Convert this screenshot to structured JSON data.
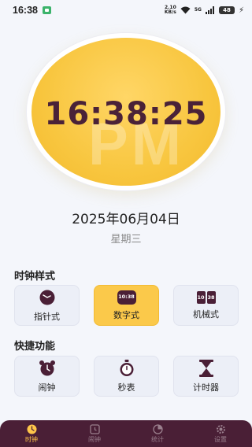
{
  "status_bar": {
    "time": "16:38",
    "net_speed_value": "2.10",
    "net_speed_unit": "KB/s",
    "network_type": "5G",
    "battery_level": "48"
  },
  "clock": {
    "time": "16:38:25",
    "period_watermark": "PM"
  },
  "date": {
    "full": "2025年06月04日",
    "weekday": "星期三"
  },
  "styles_section": {
    "title": "时钟样式",
    "items": [
      {
        "label": "指针式",
        "icon": "analog-clock-icon",
        "selected": false
      },
      {
        "label": "数字式",
        "icon": "digital-clock-icon",
        "icon_text": "10:38",
        "selected": true
      },
      {
        "label": "机械式",
        "icon": "flip-clock-icon",
        "icon_text_left": "10",
        "icon_text_right": "38",
        "selected": false
      }
    ]
  },
  "quick_section": {
    "title": "快捷功能",
    "items": [
      {
        "label": "闹钟",
        "icon": "alarm-clock-icon"
      },
      {
        "label": "秒表",
        "icon": "stopwatch-icon"
      },
      {
        "label": "计时器",
        "icon": "hourglass-icon"
      }
    ]
  },
  "tab_bar": {
    "tabs": [
      {
        "label": "时钟",
        "icon": "clock-tab-icon",
        "active": true
      },
      {
        "label": "闹钟",
        "icon": "alarm-tab-icon",
        "active": false
      },
      {
        "label": "统计",
        "icon": "pie-chart-tab-icon",
        "active": false
      },
      {
        "label": "设置",
        "icon": "gear-tab-icon",
        "active": false
      }
    ]
  },
  "colors": {
    "accent": "#fbc94a",
    "dark": "#4a1f36",
    "background": "#f4f6fb"
  }
}
